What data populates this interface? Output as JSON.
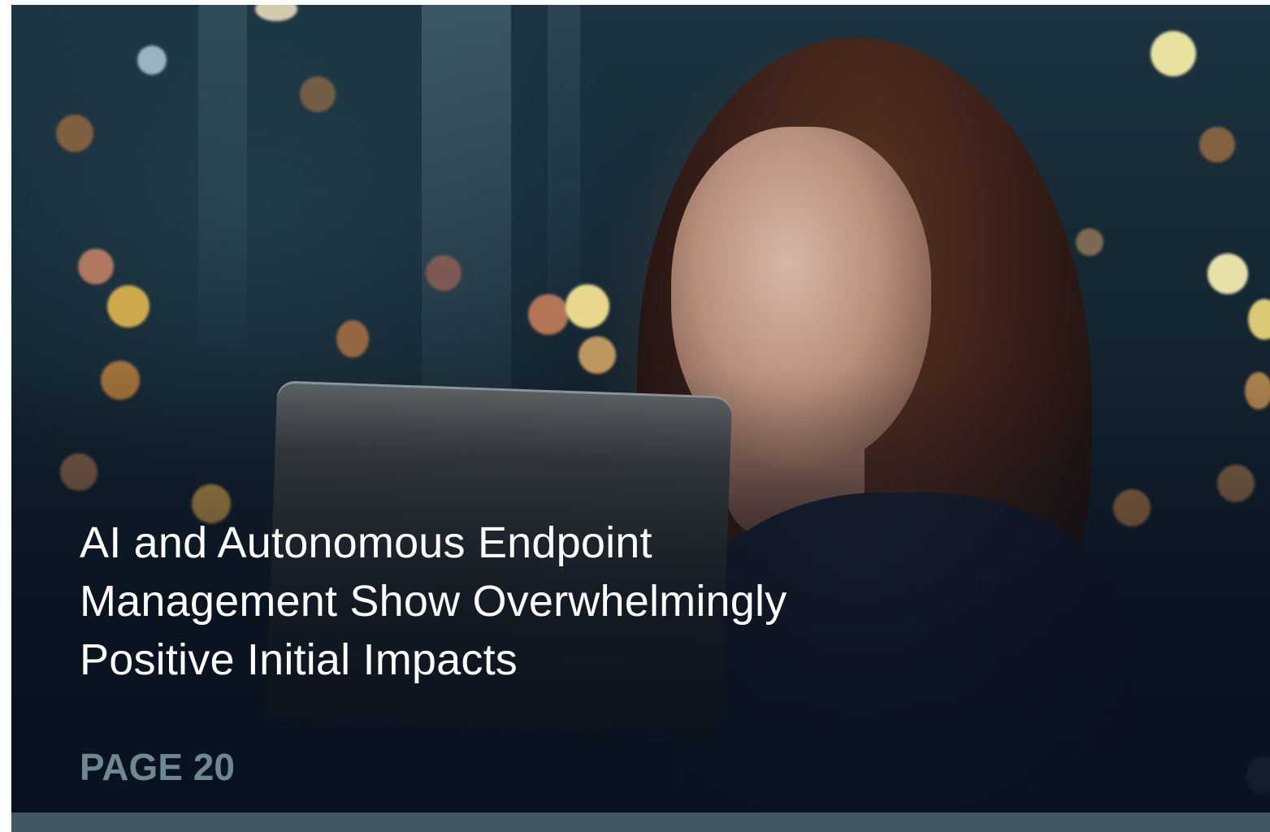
{
  "hero": {
    "title_lines": [
      "AI and Autonomous Endpoint",
      "Management Show Overwhelmingly",
      "Positive Initial Impacts"
    ],
    "page_label": "PAGE 20"
  },
  "colors": {
    "title_text": "#ffffff",
    "page_label": "#6e8791",
    "bottom_bar": "#455763"
  }
}
